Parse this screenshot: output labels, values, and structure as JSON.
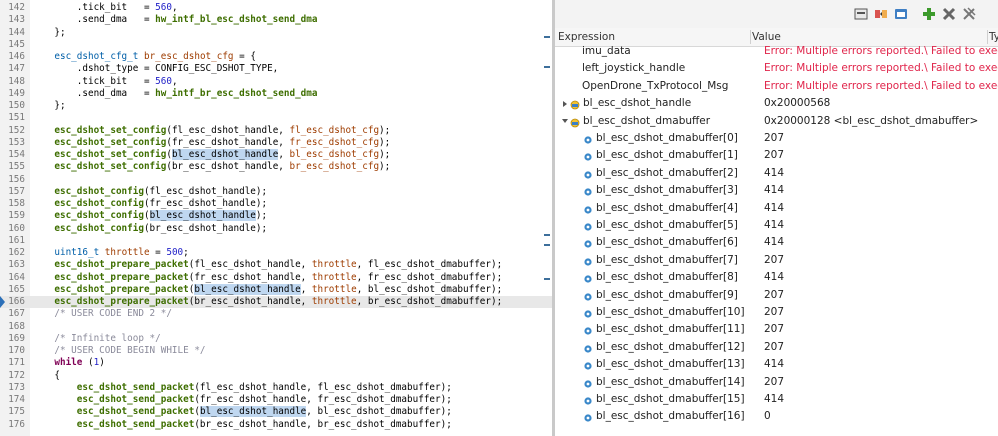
{
  "editor": {
    "lines": [
      {
        "n": "142",
        "t": [
          [
            "        .tick_bit   = ",
            ""
          ],
          [
            "560",
            "num"
          ],
          [
            ",",
            ""
          ]
        ]
      },
      {
        "n": "143",
        "t": [
          [
            "        .send_dma   = ",
            ""
          ],
          [
            "hw_intf_bl_esc_dshot_send_dma",
            "fn"
          ]
        ]
      },
      {
        "n": "144",
        "t": [
          [
            "    };",
            ""
          ]
        ]
      },
      {
        "n": "145",
        "t": []
      },
      {
        "n": "146",
        "t": [
          [
            "    ",
            ""
          ],
          [
            "esc_dshot_cfg_t",
            "type"
          ],
          [
            " ",
            ""
          ],
          [
            "br_esc_dshot_cfg",
            "var"
          ],
          [
            " = {",
            ""
          ]
        ]
      },
      {
        "n": "147",
        "t": [
          [
            "        .dshot_type = CONFIG_ESC_DSHOT_TYPE,",
            ""
          ]
        ]
      },
      {
        "n": "148",
        "t": [
          [
            "        .tick_bit   = ",
            ""
          ],
          [
            "560",
            "num"
          ],
          [
            ",",
            ""
          ]
        ]
      },
      {
        "n": "149",
        "t": [
          [
            "        .send_dma   = ",
            ""
          ],
          [
            "hw_intf_br_esc_dshot_send_dma",
            "fn"
          ]
        ]
      },
      {
        "n": "150",
        "t": [
          [
            "    };",
            ""
          ]
        ]
      },
      {
        "n": "151",
        "t": []
      },
      {
        "n": "152",
        "t": [
          [
            "    ",
            ""
          ],
          [
            "esc_dshot_set_config",
            "fn"
          ],
          [
            "(fl_esc_dshot_handle, ",
            ""
          ],
          [
            "fl_esc_dshot_cfg",
            "var"
          ],
          [
            ");",
            ""
          ]
        ]
      },
      {
        "n": "153",
        "t": [
          [
            "    ",
            ""
          ],
          [
            "esc_dshot_set_config",
            "fn"
          ],
          [
            "(fr_esc_dshot_handle, ",
            ""
          ],
          [
            "fr_esc_dshot_cfg",
            "var"
          ],
          [
            ");",
            ""
          ]
        ]
      },
      {
        "n": "154",
        "t": [
          [
            "    ",
            ""
          ],
          [
            "esc_dshot_set_config",
            "fn"
          ],
          [
            "(",
            ""
          ],
          [
            "bl_esc_dshot_handle",
            "sel"
          ],
          [
            ", ",
            ""
          ],
          [
            "bl_esc_dshot_cfg",
            "var"
          ],
          [
            ");",
            ""
          ]
        ]
      },
      {
        "n": "155",
        "t": [
          [
            "    ",
            ""
          ],
          [
            "esc_dshot_set_config",
            "fn"
          ],
          [
            "(br_esc_dshot_handle, ",
            ""
          ],
          [
            "br_esc_dshot_cfg",
            "var"
          ],
          [
            ");",
            ""
          ]
        ]
      },
      {
        "n": "156",
        "t": []
      },
      {
        "n": "157",
        "t": [
          [
            "    ",
            ""
          ],
          [
            "esc_dshot_config",
            "fn"
          ],
          [
            "(fl_esc_dshot_handle);",
            ""
          ]
        ]
      },
      {
        "n": "158",
        "t": [
          [
            "    ",
            ""
          ],
          [
            "esc_dshot_config",
            "fn"
          ],
          [
            "(fr_esc_dshot_handle);",
            ""
          ]
        ]
      },
      {
        "n": "159",
        "t": [
          [
            "    ",
            ""
          ],
          [
            "esc_dshot_config",
            "fn"
          ],
          [
            "(",
            ""
          ],
          [
            "bl_esc_dshot_handle",
            "sel"
          ],
          [
            ");",
            ""
          ]
        ]
      },
      {
        "n": "160",
        "t": [
          [
            "    ",
            ""
          ],
          [
            "esc_dshot_config",
            "fn"
          ],
          [
            "(br_esc_dshot_handle);",
            ""
          ]
        ]
      },
      {
        "n": "161",
        "t": []
      },
      {
        "n": "162",
        "t": [
          [
            "    ",
            ""
          ],
          [
            "uint16_t",
            "type"
          ],
          [
            " ",
            ""
          ],
          [
            "throttle",
            "var"
          ],
          [
            " = ",
            ""
          ],
          [
            "500",
            "num"
          ],
          [
            ";",
            ""
          ]
        ]
      },
      {
        "n": "163",
        "t": [
          [
            "    ",
            ""
          ],
          [
            "esc_dshot_prepare_packet",
            "fn"
          ],
          [
            "(fl_esc_dshot_handle, ",
            ""
          ],
          [
            "throttle",
            "var"
          ],
          [
            ", fl_esc_dshot_dmabuffer);",
            ""
          ]
        ]
      },
      {
        "n": "164",
        "t": [
          [
            "    ",
            ""
          ],
          [
            "esc_dshot_prepare_packet",
            "fn"
          ],
          [
            "(fr_esc_dshot_handle, ",
            ""
          ],
          [
            "throttle",
            "var"
          ],
          [
            ", fr_esc_dshot_dmabuffer);",
            ""
          ]
        ]
      },
      {
        "n": "165",
        "t": [
          [
            "    ",
            ""
          ],
          [
            "esc_dshot_prepare_packet",
            "fn"
          ],
          [
            "(",
            ""
          ],
          [
            "bl_esc_dshot_handle",
            "sel"
          ],
          [
            ", ",
            ""
          ],
          [
            "throttle",
            "var"
          ],
          [
            ", bl_esc_dshot_dmabuffer);",
            ""
          ]
        ]
      },
      {
        "n": "166",
        "t": [
          [
            "    ",
            ""
          ],
          [
            "esc_dshot_prepare_packet",
            "fn"
          ],
          [
            "(br_esc_dshot_handle, ",
            ""
          ],
          [
            "throttle",
            "var"
          ],
          [
            ", br_esc_dshot_dmabuffer);",
            ""
          ]
        ],
        "hl": true
      },
      {
        "n": "167",
        "t": [
          [
            "    ",
            ""
          ],
          [
            "/* USER CODE END 2 */",
            "cmt"
          ]
        ]
      },
      {
        "n": "168",
        "t": []
      },
      {
        "n": "169",
        "t": [
          [
            "    ",
            ""
          ],
          [
            "/* Infinite loop */",
            "cmt"
          ]
        ]
      },
      {
        "n": "170",
        "t": [
          [
            "    ",
            ""
          ],
          [
            "/* USER CODE BEGIN WHILE */",
            "cmt"
          ]
        ]
      },
      {
        "n": "171",
        "t": [
          [
            "    ",
            ""
          ],
          [
            "while",
            "kw"
          ],
          [
            " (",
            ""
          ],
          [
            "1",
            "num"
          ],
          [
            ")",
            ""
          ]
        ]
      },
      {
        "n": "172",
        "t": [
          [
            "    {",
            ""
          ]
        ]
      },
      {
        "n": "173",
        "t": [
          [
            "        ",
            ""
          ],
          [
            "esc_dshot_send_packet",
            "fn"
          ],
          [
            "(fl_esc_dshot_handle, fl_esc_dshot_dmabuffer);",
            ""
          ]
        ]
      },
      {
        "n": "174",
        "t": [
          [
            "        ",
            ""
          ],
          [
            "esc_dshot_send_packet",
            "fn"
          ],
          [
            "(fr_esc_dshot_handle, fr_esc_dshot_dmabuffer);",
            ""
          ]
        ]
      },
      {
        "n": "175",
        "t": [
          [
            "        ",
            ""
          ],
          [
            "esc_dshot_send_packet",
            "fn"
          ],
          [
            "(",
            ""
          ],
          [
            "bl_esc_dshot_handle",
            "sel"
          ],
          [
            ", bl_esc_dshot_dmabuffer);",
            ""
          ]
        ]
      },
      {
        "n": "176",
        "t": [
          [
            "        ",
            ""
          ],
          [
            "esc_dshot_send_packet",
            "fn"
          ],
          [
            "(br_esc_dshot_handle, br_esc_dshot_dmabuffer);",
            ""
          ]
        ]
      }
    ]
  },
  "expressions": {
    "columns": {
      "expression": "Expression",
      "value": "Value",
      "type": "Ty"
    },
    "rows": [
      {
        "exp": "imu_data",
        "val": "Error: Multiple errors reported.\\ Failed to exec",
        "err": true,
        "indent": 1
      },
      {
        "exp": "left_joystick_handle",
        "val": "Error: Multiple errors reported.\\ Failed to exec",
        "err": true,
        "indent": 1
      },
      {
        "exp": "OpenDrone_TxProtocol_Msg",
        "val": "Error: Multiple errors reported.\\ Failed to exec",
        "err": true,
        "indent": 1
      },
      {
        "exp": "bl_esc_dshot_handle",
        "val": "0x20000568",
        "twist": "collapsed",
        "icon": true,
        "indent": 0
      },
      {
        "exp": "bl_esc_dshot_dmabuffer",
        "val": "0x20000128 <bl_esc_dshot_dmabuffer>",
        "twist": "expanded",
        "icon": true,
        "indent": 0
      },
      {
        "exp": "bl_esc_dshot_dmabuffer[0]",
        "val": "207",
        "icon": true,
        "indent": 2
      },
      {
        "exp": "bl_esc_dshot_dmabuffer[1]",
        "val": "207",
        "icon": true,
        "indent": 2
      },
      {
        "exp": "bl_esc_dshot_dmabuffer[2]",
        "val": "414",
        "icon": true,
        "indent": 2
      },
      {
        "exp": "bl_esc_dshot_dmabuffer[3]",
        "val": "414",
        "icon": true,
        "indent": 2
      },
      {
        "exp": "bl_esc_dshot_dmabuffer[4]",
        "val": "414",
        "icon": true,
        "indent": 2
      },
      {
        "exp": "bl_esc_dshot_dmabuffer[5]",
        "val": "414",
        "icon": true,
        "indent": 2
      },
      {
        "exp": "bl_esc_dshot_dmabuffer[6]",
        "val": "414",
        "icon": true,
        "indent": 2
      },
      {
        "exp": "bl_esc_dshot_dmabuffer[7]",
        "val": "207",
        "icon": true,
        "indent": 2
      },
      {
        "exp": "bl_esc_dshot_dmabuffer[8]",
        "val": "414",
        "icon": true,
        "indent": 2
      },
      {
        "exp": "bl_esc_dshot_dmabuffer[9]",
        "val": "207",
        "icon": true,
        "indent": 2
      },
      {
        "exp": "bl_esc_dshot_dmabuffer[10]",
        "val": "207",
        "icon": true,
        "indent": 2
      },
      {
        "exp": "bl_esc_dshot_dmabuffer[11]",
        "val": "207",
        "icon": true,
        "indent": 2
      },
      {
        "exp": "bl_esc_dshot_dmabuffer[12]",
        "val": "207",
        "icon": true,
        "indent": 2
      },
      {
        "exp": "bl_esc_dshot_dmabuffer[13]",
        "val": "414",
        "icon": true,
        "indent": 2
      },
      {
        "exp": "bl_esc_dshot_dmabuffer[14]",
        "val": "207",
        "icon": true,
        "indent": 2
      },
      {
        "exp": "bl_esc_dshot_dmabuffer[15]",
        "val": "414",
        "icon": true,
        "indent": 2
      },
      {
        "exp": "bl_esc_dshot_dmabuffer[16]",
        "val": "0",
        "icon": true,
        "indent": 2
      }
    ]
  },
  "toolbar": {
    "icons": [
      "collapse-all-icon",
      "show-type-icon",
      "show-logical-structure-icon",
      "add-expression-icon",
      "remove-expression-icon",
      "remove-all-expressions-icon"
    ]
  },
  "colors": {
    "error": "#e0244a",
    "selection": "#bfd7f0",
    "current-line": "#e8e8e8"
  }
}
